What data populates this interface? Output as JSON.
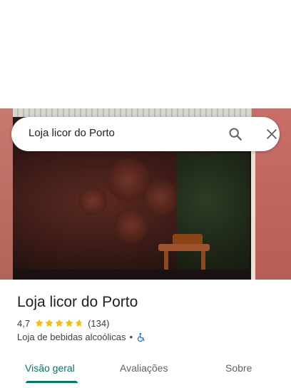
{
  "search": {
    "query": "Loja licor do Porto",
    "search_icon": "search-icon",
    "close_icon": "close-icon"
  },
  "place": {
    "name": "Loja licor do Porto",
    "rating": "4,7",
    "rating_value": 4.7,
    "max_stars": 5,
    "review_count": "(134)",
    "category": "Loja de bebidas alcoólicas",
    "separator": "•",
    "accessibility_icon": "wheelchair-icon"
  },
  "tabs": [
    {
      "label": "Visão geral",
      "active": true
    },
    {
      "label": "Avaliações",
      "active": false
    },
    {
      "label": "Sobre",
      "active": false
    }
  ],
  "colors": {
    "accent": "#00796b",
    "star": "#fbbc04",
    "star_empty": "#dadce0",
    "wheelchair": "#1a73e8",
    "text_primary": "#202124",
    "text_secondary": "#3c4043"
  }
}
